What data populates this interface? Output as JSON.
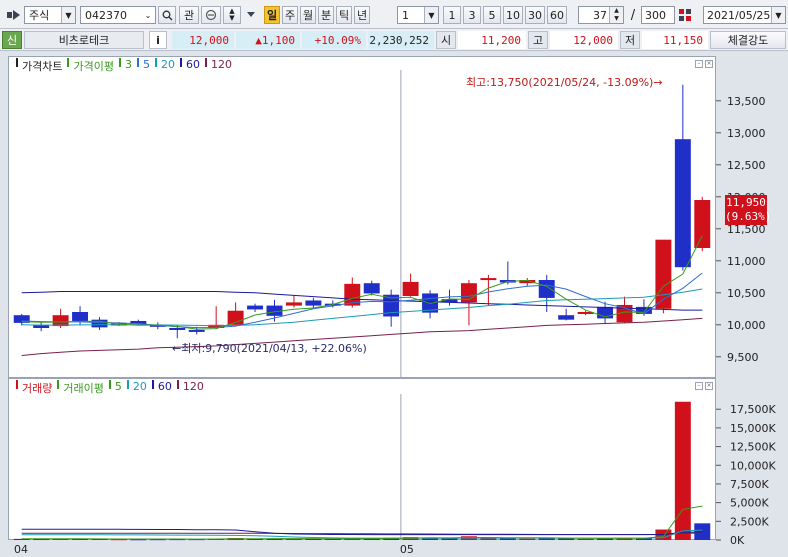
{
  "toolbar": {
    "type_select": "주식",
    "code_input": "042370",
    "btn_favorite": "관",
    "period_tabs": [
      "일",
      "주",
      "월",
      "분",
      "틱",
      "년"
    ],
    "active_period": "일",
    "interval_select": "1",
    "interval_buttons": [
      "1",
      "3",
      "5",
      "10",
      "30",
      "60"
    ],
    "view_count": "37",
    "separator": "/",
    "total_count": "300",
    "date_select": "2021/05/25"
  },
  "quote": {
    "badge": "신",
    "stock_name": "비츠로테크",
    "info_button": "i",
    "price": "12,000",
    "change": "▲1,100",
    "change_rate": "+10.09%",
    "volume": "2,230,252",
    "open_label": "시",
    "open": "11,200",
    "high_label": "고",
    "high": "12,000",
    "low_label": "저",
    "low": "11,150",
    "strength_button": "체결강도"
  },
  "price_panel": {
    "legend": [
      {
        "text": "가격차트",
        "color": "#222222"
      },
      {
        "text": "가격이평",
        "color": "#3a9a1f"
      },
      {
        "text": "3",
        "color": "#3a9a1f"
      },
      {
        "text": "5",
        "color": "#2f6fd1"
      },
      {
        "text": "20",
        "color": "#1a9bb8"
      },
      {
        "text": "60",
        "color": "#1a1aa0"
      },
      {
        "text": "120",
        "color": "#7a1f4a"
      }
    ],
    "annotation_high": "최고:13,750(2021/05/24, -13.09%)→",
    "annotation_low": "←최저:9,790(2021/04/13, +22.06%)",
    "current_price_tag": "11,950",
    "current_rate_tag": "(9.63%)"
  },
  "volume_panel": {
    "legend": [
      {
        "text": "거래량",
        "color": "#d0101b"
      },
      {
        "text": "거래이평",
        "color": "#3a9a1f"
      },
      {
        "text": "5",
        "color": "#3a9a1f"
      },
      {
        "text": "20",
        "color": "#1a9bb8"
      },
      {
        "text": "60",
        "color": "#1a1aa0"
      },
      {
        "text": "120",
        "color": "#7a1f4a"
      }
    ]
  },
  "x_axis_labels": [
    "04",
    "05"
  ],
  "chart_data": [
    {
      "type": "candlestick",
      "title": "가격차트",
      "y_ticks": [
        "13,500",
        "13,000",
        "12,500",
        "12,000",
        "11,500",
        "11,000",
        "10,500",
        "10,000",
        "9,500"
      ],
      "ylim": [
        9200,
        13950
      ],
      "candles": [
        {
          "o": 10150,
          "h": 10170,
          "l": 9990,
          "c": 10030,
          "up": false
        },
        {
          "o": 10000,
          "h": 10050,
          "l": 9900,
          "c": 9950,
          "up": false
        },
        {
          "o": 9980,
          "h": 10250,
          "l": 9950,
          "c": 10150,
          "up": true
        },
        {
          "o": 10200,
          "h": 10290,
          "l": 9990,
          "c": 10060,
          "up": false
        },
        {
          "o": 10080,
          "h": 10120,
          "l": 9920,
          "c": 9960,
          "up": false
        },
        {
          "o": 10020,
          "h": 10040,
          "l": 9980,
          "c": 10010,
          "up": true
        },
        {
          "o": 10060,
          "h": 10080,
          "l": 9990,
          "c": 10010,
          "up": false
        },
        {
          "o": 10000,
          "h": 10040,
          "l": 9930,
          "c": 9980,
          "up": false
        },
        {
          "o": 9950,
          "h": 9990,
          "l": 9790,
          "c": 9930,
          "up": false
        },
        {
          "o": 9920,
          "h": 9970,
          "l": 9850,
          "c": 9890,
          "up": false
        },
        {
          "o": 9950,
          "h": 10290,
          "l": 9930,
          "c": 10000,
          "up": true
        },
        {
          "o": 10000,
          "h": 10350,
          "l": 9990,
          "c": 10220,
          "up": true
        },
        {
          "o": 10300,
          "h": 10330,
          "l": 10200,
          "c": 10240,
          "up": false
        },
        {
          "o": 10300,
          "h": 10390,
          "l": 10050,
          "c": 10140,
          "up": false
        },
        {
          "o": 10300,
          "h": 10460,
          "l": 10270,
          "c": 10350,
          "up": true
        },
        {
          "o": 10380,
          "h": 10420,
          "l": 10250,
          "c": 10300,
          "up": false
        },
        {
          "o": 10330,
          "h": 10380,
          "l": 10270,
          "c": 10300,
          "up": false
        },
        {
          "o": 10300,
          "h": 10740,
          "l": 10270,
          "c": 10640,
          "up": true
        },
        {
          "o": 10650,
          "h": 10690,
          "l": 10460,
          "c": 10490,
          "up": false
        },
        {
          "o": 10470,
          "h": 10550,
          "l": 9970,
          "c": 10130,
          "up": false
        },
        {
          "o": 10450,
          "h": 10800,
          "l": 10440,
          "c": 10670,
          "up": true
        },
        {
          "o": 10490,
          "h": 10540,
          "l": 10100,
          "c": 10190,
          "up": false
        },
        {
          "o": 10400,
          "h": 10550,
          "l": 10300,
          "c": 10350,
          "up": false
        },
        {
          "o": 10350,
          "h": 10700,
          "l": 9990,
          "c": 10650,
          "up": true
        },
        {
          "o": 10730,
          "h": 10780,
          "l": 10300,
          "c": 10720,
          "up": true
        },
        {
          "o": 10700,
          "h": 10990,
          "l": 10630,
          "c": 10660,
          "up": false
        },
        {
          "o": 10650,
          "h": 10730,
          "l": 10600,
          "c": 10700,
          "up": true
        },
        {
          "o": 10700,
          "h": 10780,
          "l": 10200,
          "c": 10420,
          "up": false
        },
        {
          "o": 10150,
          "h": 10250,
          "l": 10070,
          "c": 10080,
          "up": false
        },
        {
          "o": 10200,
          "h": 10220,
          "l": 10150,
          "c": 10190,
          "up": true
        },
        {
          "o": 10280,
          "h": 10360,
          "l": 10010,
          "c": 10100,
          "up": false
        },
        {
          "o": 10040,
          "h": 10440,
          "l": 10020,
          "c": 10310,
          "up": true
        },
        {
          "o": 10280,
          "h": 10400,
          "l": 10140,
          "c": 10170,
          "up": false
        },
        {
          "o": 10250,
          "h": 10300,
          "l": 10180,
          "c": 11330,
          "up": true
        },
        {
          "o": 12900,
          "h": 13750,
          "l": 10850,
          "c": 10900,
          "up": false
        },
        {
          "o": 11200,
          "h": 12000,
          "l": 11150,
          "c": 11950,
          "up": true
        }
      ],
      "ma": {
        "ma3": [
          10050,
          10040,
          10043,
          10053,
          10057,
          10010,
          9993,
          9997,
          9973,
          9933,
          9940,
          10037,
          10153,
          10203,
          10243,
          10263,
          10317,
          10413,
          10477,
          10420,
          10430,
          10333,
          10403,
          10397,
          10573,
          10677,
          10693,
          10600,
          10400,
          10230,
          10123,
          10200,
          10193,
          10603,
          10793,
          11393
        ],
        "ma5": [
          10060,
          10050,
          10045,
          10045,
          10035,
          10030,
          10018,
          9990,
          9972,
          9956,
          9958,
          9980,
          10041,
          10106,
          10178,
          10250,
          10295,
          10345,
          10366,
          10360,
          10383,
          10411,
          10436,
          10446,
          10512,
          10562,
          10602,
          10621,
          10558,
          10440,
          10330,
          10264,
          10170,
          10400,
          10570,
          10810
        ],
        "ma20": [
          10000,
          9995,
          9995,
          9998,
          10000,
          10000,
          10000,
          9999,
          9995,
          9990,
          9985,
          9990,
          10000,
          10020,
          10040,
          10070,
          10100,
          10130,
          10160,
          10190,
          10210,
          10230,
          10250,
          10270,
          10300,
          10320,
          10350,
          10380,
          10390,
          10400,
          10410,
          10420,
          10430,
          10470,
          10510,
          10560
        ],
        "ma60": [
          10500,
          10510,
          10520,
          10520,
          10520,
          10520,
          10520,
          10520,
          10520,
          10520,
          10520,
          10510,
          10500,
          10480,
          10460,
          10440,
          10420,
          10400,
          10390,
          10380,
          10370,
          10360,
          10350,
          10340,
          10330,
          10320,
          10310,
          10300,
          10290,
          10280,
          10270,
          10260,
          10250,
          10240,
          10230,
          10230
        ],
        "ma120": [
          9520,
          9550,
          9570,
          9590,
          9600,
          9610,
          9620,
          9640,
          9650,
          9660,
          9670,
          9690,
          9710,
          9730,
          9750,
          9770,
          9790,
          9810,
          9830,
          9850,
          9870,
          9890,
          9900,
          9910,
          9930,
          9950,
          9970,
          9990,
          10000,
          10010,
          10020,
          10030,
          10040,
          10060,
          10080,
          10100
        ]
      }
    },
    {
      "type": "bar",
      "title": "거래량",
      "y_ticks": [
        "17,500K",
        "15,000K",
        "12,500K",
        "10,000K",
        "7,500K",
        "5,000K",
        "2,500K",
        "0K"
      ],
      "ylim": [
        0,
        19000
      ],
      "values": [
        150,
        130,
        180,
        150,
        140,
        110,
        100,
        110,
        120,
        120,
        200,
        260,
        180,
        200,
        150,
        140,
        150,
        290,
        230,
        300,
        380,
        300,
        200,
        500,
        260,
        280,
        180,
        300,
        220,
        160,
        230,
        300,
        240,
        1400,
        18500,
        2230
      ],
      "up": [
        false,
        false,
        true,
        false,
        false,
        true,
        false,
        false,
        false,
        false,
        true,
        true,
        false,
        false,
        true,
        false,
        false,
        true,
        false,
        false,
        true,
        false,
        false,
        true,
        true,
        false,
        true,
        false,
        false,
        true,
        false,
        true,
        false,
        true,
        true,
        false
      ],
      "ma": {
        "ma5": [
          180,
          170,
          160,
          160,
          150,
          140,
          130,
          130,
          130,
          120,
          130,
          160,
          180,
          190,
          190,
          190,
          170,
          190,
          190,
          220,
          260,
          300,
          280,
          340,
          330,
          310,
          290,
          300,
          250,
          230,
          220,
          240,
          230,
          470,
          4100,
          4530
        ],
        "ma20": [
          700,
          700,
          700,
          690,
          690,
          680,
          680,
          670,
          660,
          650,
          640,
          620,
          580,
          500,
          400,
          330,
          280,
          260,
          250,
          240,
          240,
          240,
          240,
          250,
          250,
          250,
          250,
          250,
          250,
          250,
          250,
          250,
          250,
          310,
          1220,
          1330
        ],
        "ma60": [
          1450,
          1450,
          1440,
          1440,
          1430,
          1430,
          1420,
          1410,
          1400,
          1380,
          1360,
          1340,
          1100,
          900,
          800,
          760,
          740,
          730,
          720,
          720,
          720,
          720,
          720,
          720,
          720,
          720,
          720,
          720,
          720,
          720,
          720,
          720,
          720,
          740,
          1040,
          1070
        ],
        "ma120": [
          900,
          900,
          900,
          900,
          900,
          900,
          900,
          900,
          900,
          900,
          900,
          900,
          890,
          880,
          870,
          860,
          850,
          840,
          830,
          820,
          810,
          800,
          790,
          780,
          770,
          760,
          750,
          740,
          740,
          740,
          740,
          740,
          740,
          750,
          900,
          920
        ]
      }
    }
  ]
}
